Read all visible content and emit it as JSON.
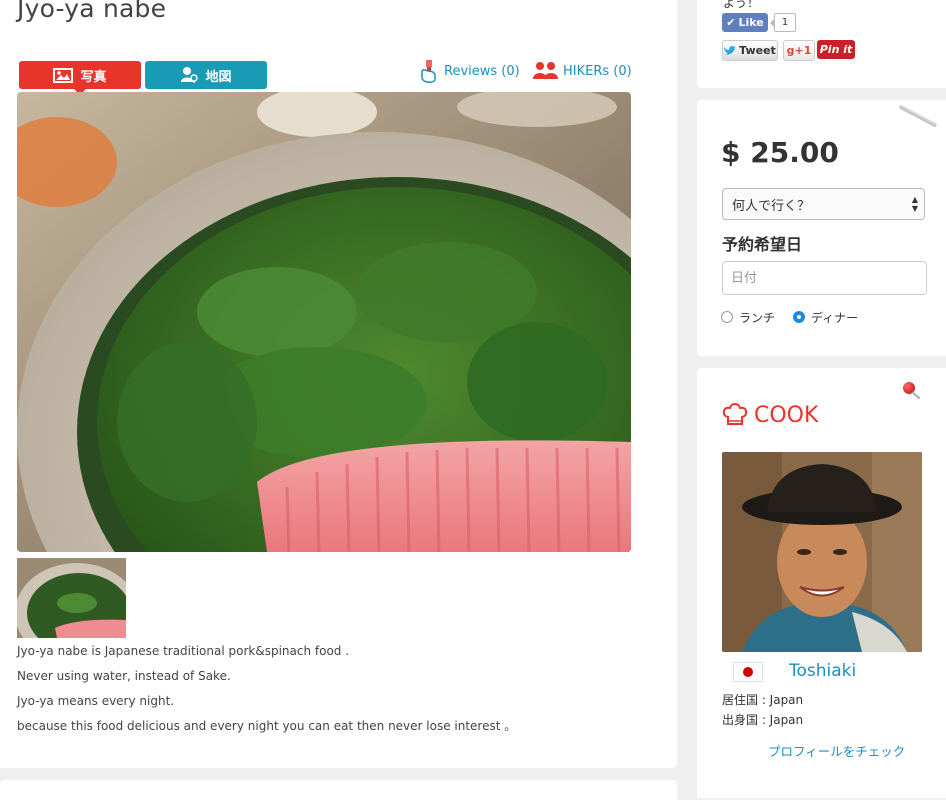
{
  "title": "Jyo-ya nabe",
  "tabs": [
    {
      "label": "写真",
      "icon": "image-icon",
      "color": "#e8352b",
      "active": true
    },
    {
      "label": "地図",
      "icon": "map-pin-user-icon",
      "color": "#1a9bb5",
      "active": false
    }
  ],
  "reviews_link": "Reviews (0)",
  "hikers_link": "HIKERs (0)",
  "description": [
    "Jyo-ya nabe is Japanese traditional pork&spinach food .",
    "Never using water, instead of Sake.",
    "Jyo-ya means every night.",
    "because this food delicious and every night you can eat then never lose interest 。"
  ],
  "social": {
    "top_note": "よう！",
    "like_label": "Like",
    "like_count": "1",
    "tweet_label": "Tweet",
    "gplus_label": "g+1",
    "pinit_label": "Pin it"
  },
  "booking": {
    "price": "$ 25.00",
    "people_select": "何人で行く？",
    "date_label": "予約希望日",
    "date_placeholder": "日付",
    "radio_lunch": "ランチ",
    "radio_dinner": "ディナー",
    "selected": "dinner"
  },
  "cook": {
    "heading": "COOK",
    "name": "Toshiaki",
    "residence": "居住国 : Japan",
    "origin": "出身国 : Japan",
    "profile_link": "プロフィールをチェック"
  },
  "colors": {
    "accent_red": "#e8352b",
    "accent_teal": "#1a9bb5",
    "link_blue": "#1a8fc0"
  }
}
